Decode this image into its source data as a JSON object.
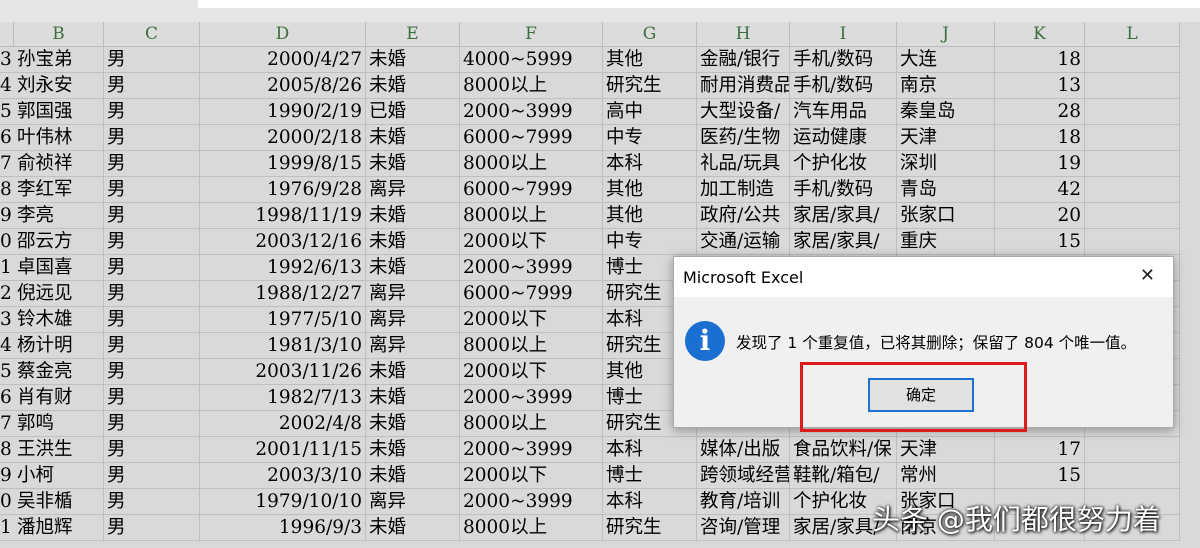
{
  "columns": [
    "B",
    "C",
    "D",
    "E",
    "F",
    "G",
    "H",
    "I",
    "J",
    "K",
    "L"
  ],
  "rows": [
    {
      "n": "3",
      "name": "孙宝弟",
      "gender": "男",
      "date": "2000/4/27",
      "marital": "未婚",
      "income": "4000~5999",
      "edu": "其他",
      "industry": "金融/银行",
      "interest": "手机/数码",
      "city": "大连",
      "age": "18"
    },
    {
      "n": "4",
      "name": "刘永安",
      "gender": "男",
      "date": "2005/8/26",
      "marital": "未婚",
      "income": "8000以上",
      "edu": "研究生",
      "industry": "耐用消费品",
      "interest": "手机/数码",
      "city": "南京",
      "age": "13"
    },
    {
      "n": "5",
      "name": "郭国强",
      "gender": "男",
      "date": "1990/2/19",
      "marital": "已婚",
      "income": "2000~3999",
      "edu": "高中",
      "industry": "大型设备/",
      "interest": "汽车用品",
      "city": "秦皇岛",
      "age": "28"
    },
    {
      "n": "6",
      "name": "叶伟林",
      "gender": "男",
      "date": "2000/2/18",
      "marital": "未婚",
      "income": "6000~7999",
      "edu": "中专",
      "industry": "医药/生物",
      "interest": "运动健康",
      "city": "天津",
      "age": "18"
    },
    {
      "n": "7",
      "name": "俞祯祥",
      "gender": "男",
      "date": "1999/8/15",
      "marital": "未婚",
      "income": "8000以上",
      "edu": "本科",
      "industry": "礼品/玩具",
      "interest": "个护化妆",
      "city": "深圳",
      "age": "19"
    },
    {
      "n": "8",
      "name": "李红军",
      "gender": "男",
      "date": "1976/9/28",
      "marital": "离异",
      "income": "6000~7999",
      "edu": "其他",
      "industry": "加工制造",
      "interest": "手机/数码",
      "city": "青岛",
      "age": "42"
    },
    {
      "n": "9",
      "name": "李亮",
      "gender": "男",
      "date": "1998/11/19",
      "marital": "未婚",
      "income": "8000以上",
      "edu": "其他",
      "industry": "政府/公共",
      "interest": "家居/家具/",
      "city": "张家口",
      "age": "20"
    },
    {
      "n": "0",
      "name": "邵云方",
      "gender": "男",
      "date": "2003/12/16",
      "marital": "未婚",
      "income": "2000以下",
      "edu": "中专",
      "industry": "交通/运输",
      "interest": "家居/家具/",
      "city": "重庆",
      "age": "15"
    },
    {
      "n": "1",
      "name": "卓国喜",
      "gender": "男",
      "date": "1992/6/13",
      "marital": "未婚",
      "income": "2000~3999",
      "edu": "博士",
      "industry": "",
      "interest": "",
      "city": "",
      "age": ""
    },
    {
      "n": "2",
      "name": "倪远见",
      "gender": "男",
      "date": "1988/12/27",
      "marital": "离异",
      "income": "6000~7999",
      "edu": "研究生",
      "industry": "",
      "interest": "",
      "city": "",
      "age": ""
    },
    {
      "n": "3",
      "name": "铃木雄",
      "gender": "男",
      "date": "1977/5/10",
      "marital": "离异",
      "income": "2000以下",
      "edu": "本科",
      "industry": "",
      "interest": "",
      "city": "",
      "age": ""
    },
    {
      "n": "4",
      "name": "杨计明",
      "gender": "男",
      "date": "1981/3/10",
      "marital": "离异",
      "income": "8000以上",
      "edu": "研究生",
      "industry": "",
      "interest": "",
      "city": "",
      "age": ""
    },
    {
      "n": "5",
      "name": "蔡金亮",
      "gender": "男",
      "date": "2003/11/26",
      "marital": "未婚",
      "income": "2000以下",
      "edu": "其他",
      "industry": "",
      "interest": "",
      "city": "",
      "age": ""
    },
    {
      "n": "6",
      "name": "肖有财",
      "gender": "男",
      "date": "1982/7/13",
      "marital": "未婚",
      "income": "2000~3999",
      "edu": "博士",
      "industry": "",
      "interest": "",
      "city": "",
      "age": ""
    },
    {
      "n": "7",
      "name": "郭鸣",
      "gender": "男",
      "date": "2002/4/8",
      "marital": "未婚",
      "income": "8000以上",
      "edu": "研究生",
      "industry": "",
      "interest": "",
      "city": "",
      "age": ""
    },
    {
      "n": "8",
      "name": "王洪生",
      "gender": "男",
      "date": "2001/11/15",
      "marital": "未婚",
      "income": "2000~3999",
      "edu": "本科",
      "industry": "媒体/出版",
      "interest": "食品饮料/保",
      "city": "天津",
      "age": "17"
    },
    {
      "n": "9",
      "name": "小柯",
      "gender": "男",
      "date": "2003/3/10",
      "marital": "未婚",
      "income": "2000以下",
      "edu": "博士",
      "industry": "跨领域经营",
      "interest": "鞋靴/箱包/",
      "city": "常州",
      "age": "15"
    },
    {
      "n": "0",
      "name": "吴非楯",
      "gender": "男",
      "date": "1979/10/10",
      "marital": "离异",
      "income": "2000~3999",
      "edu": "本科",
      "industry": "教育/培训",
      "interest": "个护化妆",
      "city": "张家口",
      "age": ""
    },
    {
      "n": "1",
      "name": "潘旭辉",
      "gender": "男",
      "date": "1996/9/3",
      "marital": "未婚",
      "income": "8000以上",
      "edu": "研究生",
      "industry": "咨询/管理",
      "interest": "家居/家具/",
      "city": "南京",
      "age": ""
    }
  ],
  "dialog": {
    "title": "Microsoft Excel",
    "close_glyph": "✕",
    "info_glyph": "i",
    "message": "发现了 1 个重复值，已将其删除；保留了 804 个唯一值。",
    "ok_label": "确定"
  },
  "watermark": "头条 @我们都很努力着",
  "colors": {
    "highlight": "#e01a1a",
    "info_icon": "#1b6fd1",
    "ok_border": "#1a73d0"
  }
}
